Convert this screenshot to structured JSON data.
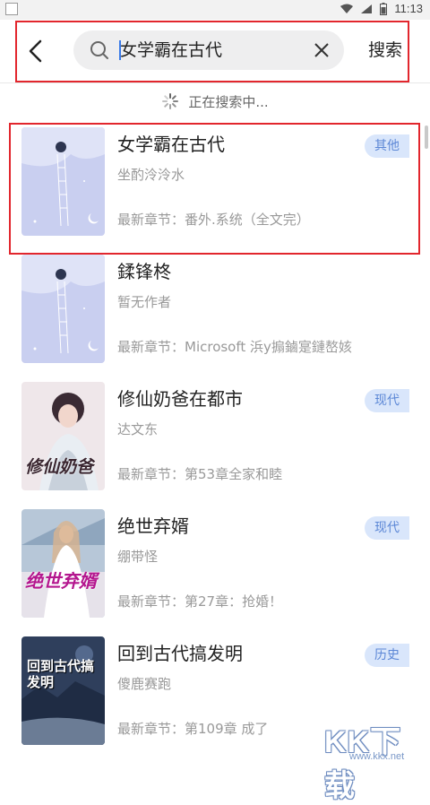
{
  "status_bar": {
    "time": "11:13"
  },
  "header": {
    "search_query": "女学霸在古代",
    "search_button": "搜索"
  },
  "loading_text": "正在搜索中...",
  "results": [
    {
      "title": "女学霸在古代",
      "author": "坐酌泠泠水",
      "latest": "最新章节：番外.系统（全文完）",
      "tag": "其他"
    },
    {
      "title": "鍒锋柊",
      "author": "暂无作者",
      "latest": "最新章节：Microsoft 浜у搧鏀寔鏈嶅姟",
      "tag": ""
    },
    {
      "title": "修仙奶爸在都市",
      "author": "达文东",
      "latest": "最新章节：第53章全家和睦",
      "tag": "现代",
      "cover_text": "修仙奶爸"
    },
    {
      "title": "绝世弃婿",
      "author": "绷带怪",
      "latest": "最新章节：第27章：抢婚！",
      "tag": "现代",
      "cover_text": "绝世弃婿"
    },
    {
      "title": "回到古代搞发明",
      "author": "傻鹿赛跑",
      "latest": "最新章节：第109章 成了",
      "tag": "历史",
      "cover_text": "回到古代搞发明"
    }
  ],
  "watermark": {
    "main": "KK下载",
    "sub": "www.kkx.net"
  },
  "colors": {
    "highlight_box": "#e2262d",
    "tag_bg": "#d9e6fb",
    "tag_text": "#5c87d6",
    "caret": "#3a7ae8"
  }
}
